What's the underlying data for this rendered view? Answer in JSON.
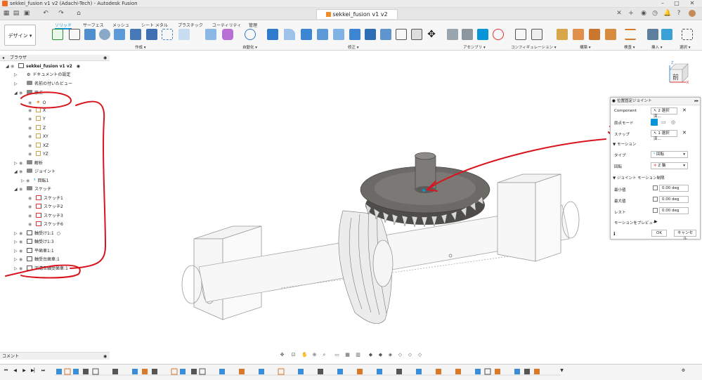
{
  "window": {
    "title": "sekkei_fusion v1 v2 (Adachi-Tech) - Autodesk Fusion",
    "doc_tab": "sekkei_fusion v1 v2"
  },
  "ribbon": {
    "workspace": "デザイン ▾",
    "tabs": [
      "ソリッド",
      "サーフェス",
      "メッシュ",
      "シート メタル",
      "プラスチック",
      "ユーティリティ",
      "管理"
    ],
    "groups": [
      "作成 ▾",
      "自動化 ▾",
      "修正 ▾",
      "アセンブリ ▾",
      "コンフィギュレーション ▾",
      "構築 ▾",
      "検査 ▾",
      "挿入 ▾",
      "選択 ▾"
    ]
  },
  "browser": {
    "header": "ブラウザ",
    "root": "sekkei_fusion v1 v2",
    "items": [
      {
        "label": "ドキュメントの設定"
      },
      {
        "label": "名前の付いたビュー"
      },
      {
        "label": "原点"
      },
      {
        "label": "O"
      },
      {
        "label": "X"
      },
      {
        "label": "Y"
      },
      {
        "label": "Z"
      },
      {
        "label": "XY"
      },
      {
        "label": "XZ"
      },
      {
        "label": "YZ"
      },
      {
        "label": "解析"
      },
      {
        "label": "ジョイント"
      },
      {
        "label": "回転1"
      },
      {
        "label": "スケッチ"
      },
      {
        "label": "スケッチ1"
      },
      {
        "label": "スケッチ2"
      },
      {
        "label": "スケッチ3"
      },
      {
        "label": "スケッチ6"
      },
      {
        "label": "軸受け1:1"
      },
      {
        "label": "軸受け1:3"
      },
      {
        "label": "平歯車1:1"
      },
      {
        "label": "軸受台歯車:1"
      },
      {
        "label": "深溝玉軸受歯車:1"
      }
    ]
  },
  "comments": {
    "label": "コメント"
  },
  "joint_panel": {
    "title": "位置固定ジョイント",
    "component_label": "Component",
    "component_value": "2 選択済...",
    "origin_mode_label": "原点モード",
    "snap_label": "スナップ",
    "snap_value": "1 選択済...",
    "motion_section": "モーション",
    "type_label": "タイプ",
    "type_value": "回転",
    "rotation_label": "回転",
    "rotation_value": "Z 軸",
    "limits_section": "ジョイント モーション制限",
    "min_label": "最小値",
    "min_value": "0.00 deg",
    "max_label": "最大値",
    "max_value": "0.00 deg",
    "rest_label": "レスト",
    "rest_value": "0.00 deg",
    "preview_label": "モーションをプレビュー",
    "ok": "OK",
    "cancel": "キャンセル"
  },
  "viewcube": {
    "face": "前",
    "axis_x": "X",
    "axis_z": "Z"
  },
  "colors": {
    "accent": "#0696d7",
    "annotation": "#d9141e",
    "gear": "#6b6a66"
  }
}
